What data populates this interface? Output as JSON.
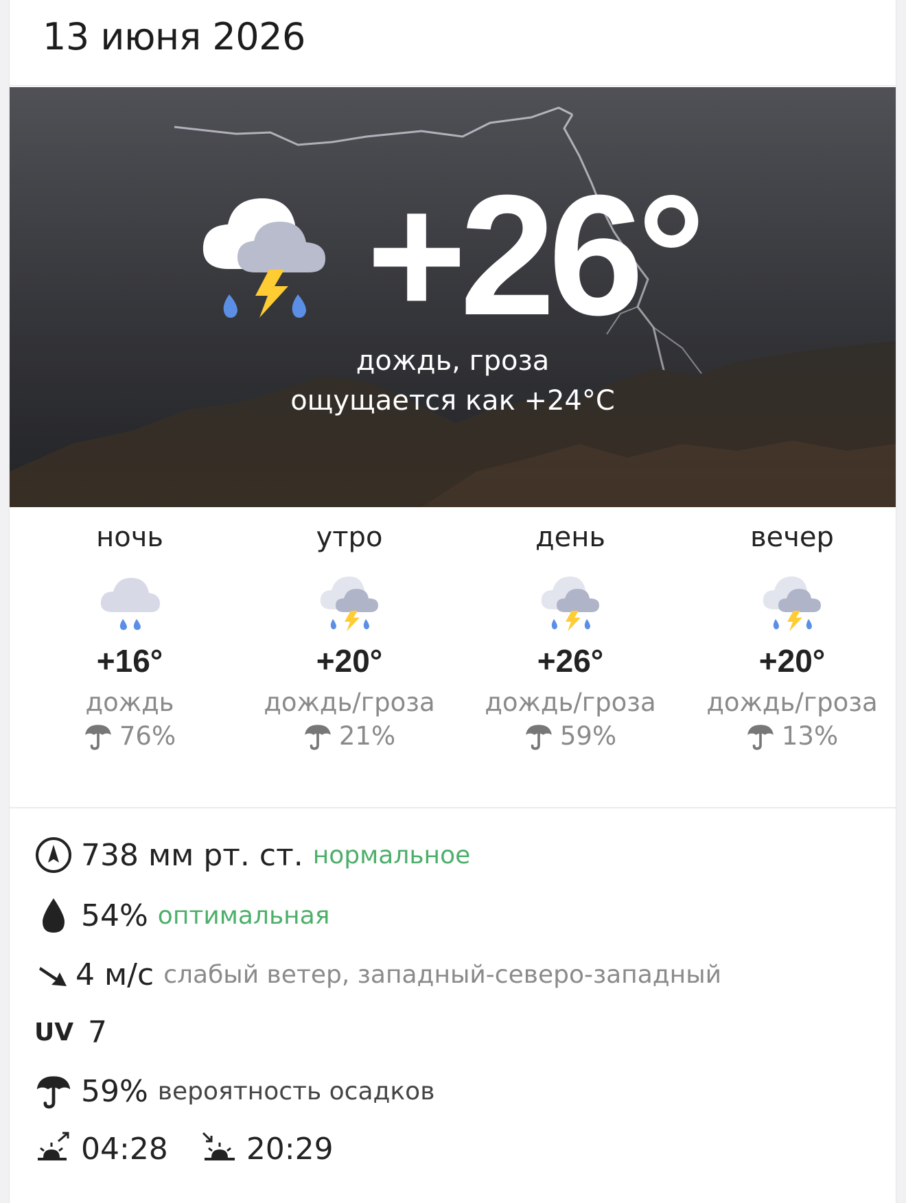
{
  "header": {
    "date": "13 июня 2026"
  },
  "now": {
    "temperature": "+26°",
    "condition": "дождь, гроза",
    "feels_like": "ощущается как +24°C",
    "icon": "cloud-thunder-rain-icon"
  },
  "periods": [
    {
      "name": "ночь",
      "temp": "+16°",
      "condition": "дождь",
      "precip": "76%",
      "icon": "cloud-rain-icon"
    },
    {
      "name": "утро",
      "temp": "+20°",
      "condition": "дождь/гроза",
      "precip": "21%",
      "icon": "cloud-thunder-rain-icon"
    },
    {
      "name": "день",
      "temp": "+26°",
      "condition": "дождь/гроза",
      "precip": "59%",
      "icon": "cloud-thunder-rain-icon"
    },
    {
      "name": "вечер",
      "temp": "+20°",
      "condition": "дождь/гроза",
      "precip": "13%",
      "icon": "cloud-thunder-rain-icon"
    }
  ],
  "details": {
    "pressure": {
      "value": "738 мм рт. ст.",
      "status": "нормальное",
      "icon": "compass-icon"
    },
    "humidity": {
      "value": "54%",
      "status": "оптимальная",
      "icon": "drop-icon"
    },
    "wind": {
      "value": "4 м/с",
      "description": "слабый ветер, западный-северо-западный",
      "icon": "wind-arrow-icon"
    },
    "uv": {
      "label": "UV",
      "value": "7"
    },
    "precipitation": {
      "value": "59%",
      "description": "вероятность осадков",
      "icon": "umbrella-icon"
    },
    "sun": {
      "sunrise": "04:28",
      "sunset": "20:29"
    }
  },
  "colors": {
    "good": "#4caf6a",
    "muted": "#8a8a8a",
    "rain_drop": "#5b8fe6",
    "lightning": "#ffcc33"
  }
}
